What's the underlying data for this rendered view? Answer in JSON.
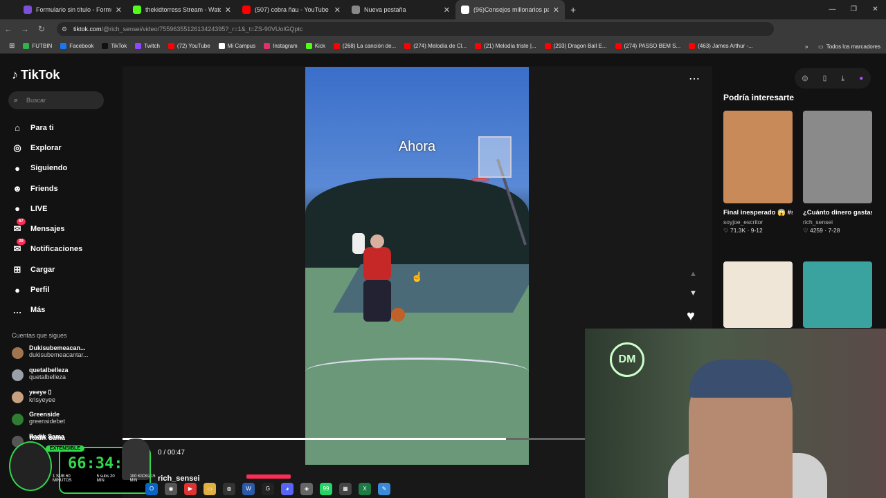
{
  "browser": {
    "tabs": [
      {
        "title": "Formulario sin título - Formular",
        "color": "#7b4fd8"
      },
      {
        "title": "thekidtorress Stream - Watch L",
        "color": "#53fc18"
      },
      {
        "title": "(507) cobra ñau - YouTube",
        "color": "#ff0000"
      },
      {
        "title": "Nueva pestaña",
        "color": "#888888"
      },
      {
        "title": "(96)Consejos millonarios pa",
        "color": "#ffffff"
      }
    ],
    "url_host": "tiktok.com",
    "url_path": "/@rich_sensei/video/7559635512613424395?_r=1&_t=ZS-90VUolGQptc",
    "bookmarks": [
      {
        "label": "FUTBIN",
        "color": "#2fb34a"
      },
      {
        "label": "Facebook",
        "color": "#1877f2"
      },
      {
        "label": "TikTok",
        "color": "#111111"
      },
      {
        "label": "Twitch",
        "color": "#9146ff"
      },
      {
        "label": "(72) YouTube",
        "color": "#ff0000"
      },
      {
        "label": "Mi Campus",
        "color": "#ffffff"
      },
      {
        "label": "Instagram",
        "color": "#e1306c"
      },
      {
        "label": "Kick",
        "color": "#53fc18"
      },
      {
        "label": "(268) La canción de...",
        "color": "#ff0000"
      },
      {
        "label": "(274) Melodía de Cl...",
        "color": "#ff0000"
      },
      {
        "label": "(21) Melodía triste |...",
        "color": "#ff0000"
      },
      {
        "label": "(293) Dragon Ball E...",
        "color": "#ff0000"
      },
      {
        "label": "(274) PASSO BEM S...",
        "color": "#ff0000"
      },
      {
        "label": "(463) James Arthur -...",
        "color": "#ff0000"
      }
    ],
    "all_bookmarks": "Todos los marcadores"
  },
  "tiktok": {
    "logo": "TikTok",
    "search_placeholder": "Buscar",
    "nav": [
      {
        "label": "Para ti",
        "icon": "home-icon",
        "glyph": "⌂",
        "badge": ""
      },
      {
        "label": "Explorar",
        "icon": "compass-icon",
        "glyph": "◎",
        "badge": ""
      },
      {
        "label": "Siguiendo",
        "icon": "following-icon",
        "glyph": "●",
        "badge": ""
      },
      {
        "label": "Friends",
        "icon": "friends-icon",
        "glyph": "☻",
        "badge": ""
      },
      {
        "label": "LIVE",
        "icon": "live-icon",
        "glyph": "●",
        "badge": ""
      },
      {
        "label": "Mensajes",
        "icon": "messages-icon",
        "glyph": "✉",
        "badge": "67"
      },
      {
        "label": "Notificaciones",
        "icon": "bell-icon",
        "glyph": "✉",
        "badge": "29"
      },
      {
        "label": "Cargar",
        "icon": "upload-icon",
        "glyph": "⊞",
        "badge": ""
      },
      {
        "label": "Perfil",
        "icon": "profile-icon",
        "glyph": "●",
        "badge": ""
      },
      {
        "label": "Más",
        "icon": "more-icon",
        "glyph": "…",
        "badge": ""
      }
    ],
    "following_header": "Cuentas que sigues",
    "following": [
      {
        "name": "Dukisubemeacan...",
        "handle": "dukisubemeacantar...",
        "color": "#a0744f"
      },
      {
        "name": "quetalbelleza",
        "handle": "quetalbelleza",
        "color": "#9aa0a8"
      },
      {
        "name": "yeeye ⌷",
        "handle": "krisyeyee",
        "color": "#c8a080"
      },
      {
        "name": "Greenside",
        "handle": "greensidebet",
        "color": "#2e7d32"
      },
      {
        "name": "Radik Sama",
        "handle": "",
        "color": "#555555"
      }
    ],
    "video": {
      "overlay_text": "Ahora",
      "time": "00:30 / 00:47",
      "time_shown": "0 / 00:47",
      "progress": 0.83,
      "author": "rich_sensei"
    },
    "recommend": {
      "title": "Podría interesarte",
      "cards": [
        {
          "title": "Final inesperado 😱 #siemprecontigola...",
          "author": "soyjoe_escritor",
          "stats": "♡ 71.3K · 9-12",
          "color": "#c98a5a"
        },
        {
          "title": "¿Cuánto dinero gastaste ayer? 🧠 |...",
          "author": "rich_sensei",
          "stats": "♡ 4259 · 7-28",
          "color": "#8a8a8a"
        }
      ]
    }
  },
  "stream_overlay": {
    "name": "Radik Sama",
    "tag": "EXTENSIBLE",
    "timer": "66:34:52",
    "bottom": [
      "1 SUB 60 MINUTOS",
      "5 subs 20 MIN",
      "100 KICKs 15 MIN"
    ]
  }
}
